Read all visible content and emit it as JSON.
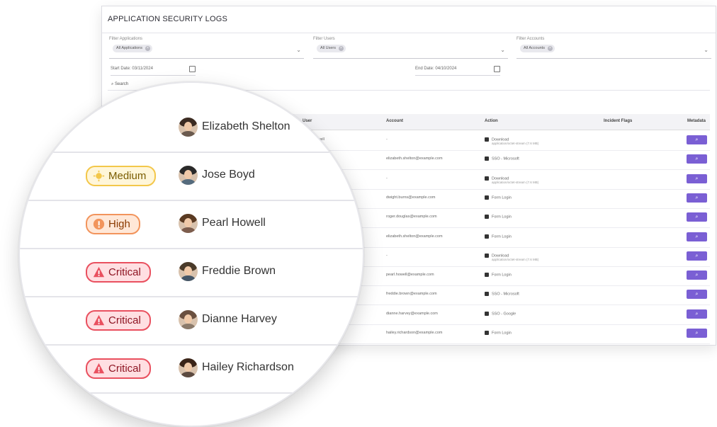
{
  "app": {
    "title": "APPLICATION SECURITY LOGS",
    "filters": [
      {
        "label": "Filter Applications",
        "chip": "All Applications"
      },
      {
        "label": "Filter Users",
        "chip": "All Users"
      },
      {
        "label": "Filter Accounts",
        "chip": "All Accounts"
      }
    ],
    "start_date": {
      "label": "Start Date:",
      "value": "03/11/2024"
    },
    "end_date": {
      "label": "End Date:",
      "value": "04/10/2024"
    },
    "search_label": "Search",
    "columns": [
      "User",
      "Account",
      "Action",
      "Incident Flags",
      "Metadata"
    ],
    "rows": [
      {
        "user": "Pearl Howell",
        "account": "-",
        "action": "Download",
        "action_sub": "application/octet-stream (7.6 MB)"
      },
      {
        "user": "Elizabeth Shelton",
        "account": "elizabeth.shelton@example.com",
        "action": "SSO - Microsoft",
        "action_sub": ""
      },
      {
        "user": "Jose Boyd",
        "account": "-",
        "action": "Download",
        "action_sub": "application/octet-stream (7.6 MB)"
      },
      {
        "user": "",
        "account": "dwight.burns@example.com",
        "action": "Form Login",
        "action_sub": ""
      },
      {
        "user": "",
        "account": "roger.douglas@example.com",
        "action": "Form Login",
        "action_sub": ""
      },
      {
        "user": "",
        "account": "elizabeth.shelton@example.com",
        "action": "Form Login",
        "action_sub": ""
      },
      {
        "user": "",
        "account": "-",
        "action": "Download",
        "action_sub": "application/octet-stream (7.6 MB)"
      },
      {
        "user": "",
        "account": "pearl.howell@example.com",
        "action": "Form Login",
        "action_sub": ""
      },
      {
        "user": "",
        "account": "freddie.brown@example.com",
        "action": "SSO - Microsoft",
        "action_sub": ""
      },
      {
        "user": "",
        "account": "dianne.harvey@example.com",
        "action": "SSO - Google",
        "action_sub": ""
      },
      {
        "user": "Hailey Richardson",
        "account": "hailey.richardson@example.com",
        "action": "Form Login",
        "action_sub": ""
      }
    ]
  },
  "magnified": {
    "rows": [
      {
        "flag": "",
        "user": "Elizabeth Shelton"
      },
      {
        "flag": "Medium",
        "user": "Jose Boyd"
      },
      {
        "flag": "High",
        "user": "Pearl Howell"
      },
      {
        "flag": "Critical",
        "user": "Freddie Brown"
      },
      {
        "flag": "Critical",
        "user": "Dianne Harvey"
      },
      {
        "flag": "Critical",
        "user": "Hailey Richardson"
      }
    ]
  },
  "colors": {
    "accent": "#7a5fd4",
    "medium": "#f3c74a",
    "high": "#f2945c",
    "critical": "#e9505f"
  },
  "icons": {
    "search": "search-icon",
    "calendar": "calendar-icon",
    "chevron": "chevron-down-icon",
    "medium": "sun-icon",
    "high": "info-circle-icon",
    "critical": "warning-triangle-icon"
  }
}
